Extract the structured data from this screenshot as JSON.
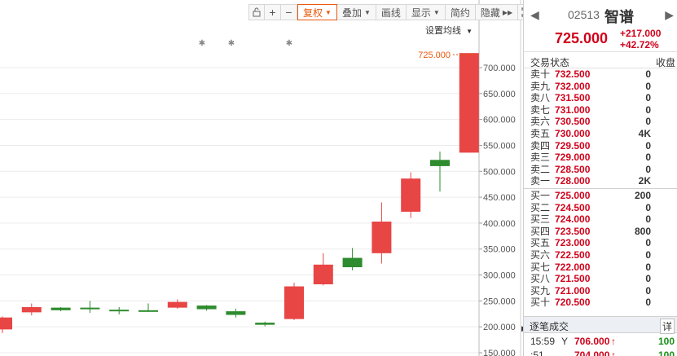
{
  "toolbar": {
    "lock_icon": "lock-icon",
    "zoom_in": "+",
    "zoom_out": "−",
    "restore_rights": "复权",
    "overlay": "叠加",
    "draw_line": "画线",
    "display": "显示",
    "simple": "简约",
    "hide": "隐藏",
    "fullscreen_icon": "expand-icon"
  },
  "ma_setting": "设置均线",
  "chart_data": {
    "type": "candlestick",
    "y_ticks": [
      "700.000",
      "650.000",
      "600.000",
      "550.000",
      "500.000",
      "450.000",
      "400.000",
      "350.000",
      "300.000",
      "250.000",
      "200.000",
      "150.000"
    ],
    "ylim": [
      150,
      735
    ],
    "last_price_label": "725.000",
    "candles": [
      {
        "open": 195,
        "close": 218,
        "high": 220,
        "low": 188,
        "dir": "up"
      },
      {
        "open": 228,
        "close": 238,
        "high": 245,
        "low": 222,
        "dir": "up"
      },
      {
        "open": 232,
        "close": 237,
        "high": 238,
        "low": 230,
        "dir": "down"
      },
      {
        "open": 234,
        "close": 237,
        "high": 250,
        "low": 227,
        "dir": "down"
      },
      {
        "open": 232,
        "close": 233,
        "high": 238,
        "low": 224,
        "dir": "down"
      },
      {
        "open": 231,
        "close": 232,
        "high": 245,
        "low": 229,
        "dir": "down"
      },
      {
        "open": 237,
        "close": 248,
        "high": 253,
        "low": 235,
        "dir": "up"
      },
      {
        "open": 234,
        "close": 241,
        "high": 242,
        "low": 231,
        "dir": "down"
      },
      {
        "open": 223,
        "close": 230,
        "high": 235,
        "low": 218,
        "dir": "down"
      },
      {
        "open": 204,
        "close": 208,
        "high": 210,
        "low": 201,
        "dir": "down"
      },
      {
        "open": 215,
        "close": 278,
        "high": 285,
        "low": 213,
        "dir": "up"
      },
      {
        "open": 282,
        "close": 320,
        "high": 342,
        "low": 280,
        "dir": "up"
      },
      {
        "open": 315,
        "close": 333,
        "high": 352,
        "low": 309,
        "dir": "down"
      },
      {
        "open": 342,
        "close": 403,
        "high": 440,
        "low": 322,
        "dir": "up"
      },
      {
        "open": 422,
        "close": 486,
        "high": 498,
        "low": 410,
        "dir": "up"
      },
      {
        "open": 510,
        "close": 522,
        "high": 538,
        "low": 461,
        "dir": "down"
      },
      {
        "open": 536,
        "close": 728,
        "high": 728,
        "low": 536,
        "dir": "up"
      }
    ],
    "markers": [
      "✱",
      "✱",
      "✱"
    ]
  },
  "quote": {
    "nav_prev": "◀",
    "code": "02513",
    "name": "智谱",
    "nav_next": "▶",
    "last_price": "725.000",
    "change_abs": "+217.000",
    "change_pct": "+42.72%",
    "status_label": "交易状态",
    "status_value": "收盘",
    "asks": [
      {
        "label": "卖十",
        "price": "732.500",
        "vol": "0"
      },
      {
        "label": "卖九",
        "price": "732.000",
        "vol": "0"
      },
      {
        "label": "卖八",
        "price": "731.500",
        "vol": "0"
      },
      {
        "label": "卖七",
        "price": "731.000",
        "vol": "0"
      },
      {
        "label": "卖六",
        "price": "730.500",
        "vol": "0"
      },
      {
        "label": "卖五",
        "price": "730.000",
        "vol": "4K"
      },
      {
        "label": "卖四",
        "price": "729.500",
        "vol": "0"
      },
      {
        "label": "卖三",
        "price": "729.000",
        "vol": "0"
      },
      {
        "label": "卖二",
        "price": "728.500",
        "vol": "0"
      },
      {
        "label": "卖一",
        "price": "728.000",
        "vol": "2K"
      }
    ],
    "bids": [
      {
        "label": "买一",
        "price": "725.000",
        "vol": "200"
      },
      {
        "label": "买二",
        "price": "724.500",
        "vol": "0"
      },
      {
        "label": "买三",
        "price": "724.000",
        "vol": "0"
      },
      {
        "label": "买四",
        "price": "723.500",
        "vol": "800"
      },
      {
        "label": "买五",
        "price": "723.000",
        "vol": "0"
      },
      {
        "label": "买六",
        "price": "722.500",
        "vol": "0"
      },
      {
        "label": "买七",
        "price": "722.000",
        "vol": "0"
      },
      {
        "label": "买八",
        "price": "721.500",
        "vol": "0"
      },
      {
        "label": "买九",
        "price": "721.000",
        "vol": "0"
      },
      {
        "label": "买十",
        "price": "720.500",
        "vol": "0"
      }
    ],
    "trades_label": "逐笔成交",
    "trades_detail": "详",
    "trades": [
      {
        "time": "15:59",
        "flag": "Y",
        "price": "706.000",
        "arrow": "↑",
        "vol": "100"
      },
      {
        "time": ":51",
        "flag": "",
        "price": "704.000",
        "arrow": "↑",
        "vol": "100"
      }
    ],
    "collapse": "▶"
  },
  "colors": {
    "up": "#e84545",
    "down": "#2e8b2e",
    "price_red": "#d0021b",
    "accent": "#e8590c"
  }
}
